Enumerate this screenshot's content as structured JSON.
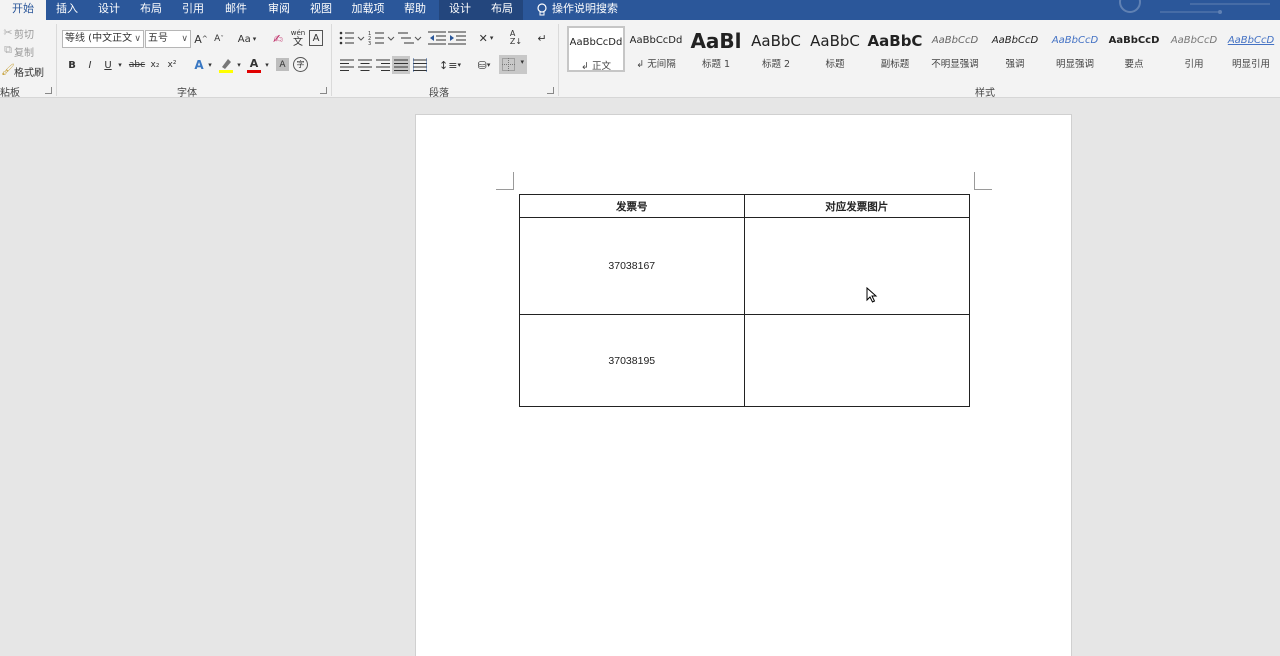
{
  "tabs": [
    {
      "label": "开始",
      "active": true
    },
    {
      "label": "插入"
    },
    {
      "label": "设计"
    },
    {
      "label": "布局"
    },
    {
      "label": "引用"
    },
    {
      "label": "邮件"
    },
    {
      "label": "审阅"
    },
    {
      "label": "视图"
    },
    {
      "label": "加载项"
    },
    {
      "label": "帮助"
    },
    {
      "label": "设计",
      "contextual": true
    },
    {
      "label": "布局",
      "contextual": true
    }
  ],
  "tell_me": "操作说明搜索",
  "clipboard": {
    "cut": "剪切",
    "copy": "复制",
    "format_painter": "格式刷",
    "group_label": "粘板"
  },
  "font": {
    "font_name": "等线 (中文正文",
    "font_size": "五号",
    "group_label": "字体",
    "bold": "B",
    "italic": "I",
    "underline": "U",
    "strike": "abc",
    "subscript": "x₂",
    "superscript": "x²",
    "grow": "A",
    "shrink": "A",
    "change_case": "Aa",
    "phonetic_top": "wén",
    "phonetic_bottom": "文",
    "char_border": "A",
    "text_effect": "A",
    "font_color": "A",
    "char_shading": "A",
    "enclose": "字"
  },
  "paragraph": {
    "group_label": "段落"
  },
  "styles": {
    "group_label": "样式",
    "items": [
      {
        "sample": "AaBbCcDd",
        "name": "↲ 正文",
        "selected": true
      },
      {
        "sample": "AaBbCcDd",
        "name": "↲ 无间隔"
      },
      {
        "sample": "AaBl",
        "name": "标题 1"
      },
      {
        "sample": "AaBbC",
        "name": "标题 2"
      },
      {
        "sample": "AaBbC",
        "name": "标题"
      },
      {
        "sample": "AaBbC",
        "name": "副标题"
      },
      {
        "sample": "AaBbCcD",
        "name": "不明显强调"
      },
      {
        "sample": "AaBbCcD",
        "name": "强调"
      },
      {
        "sample": "AaBbCcD",
        "name": "明显强调"
      },
      {
        "sample": "AaBbCcD",
        "name": "要点"
      },
      {
        "sample": "AaBbCcD",
        "name": "引用"
      },
      {
        "sample": "AaBbCcD",
        "name": "明显引用"
      }
    ]
  },
  "table": {
    "headers": [
      "发票号",
      "对应发票图片"
    ],
    "rows": [
      [
        "37038167",
        ""
      ],
      [
        "37038195",
        ""
      ]
    ]
  },
  "colors": {
    "accent": "#2b579a",
    "highlight": "#ffff00",
    "font_color": "#e00000"
  }
}
